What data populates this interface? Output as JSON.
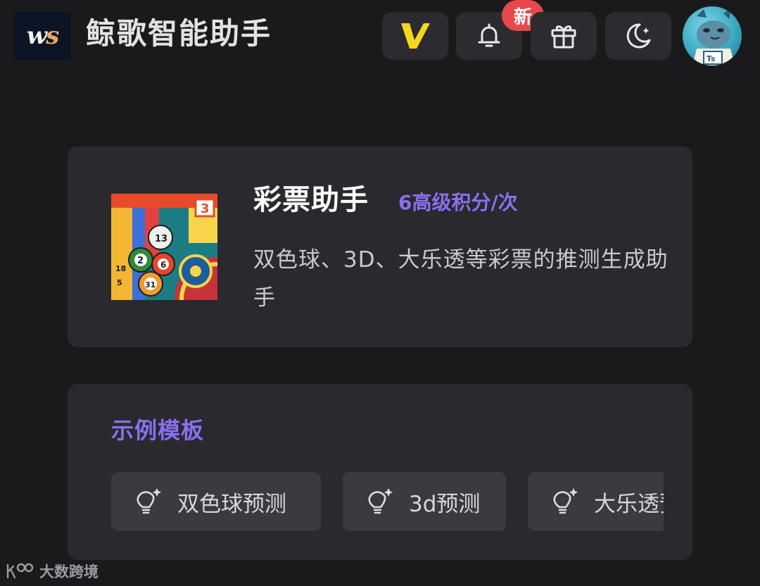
{
  "header": {
    "logo_text_w": "w",
    "logo_text_s": "s",
    "title": "鲸歌智能助手",
    "new_badge": "新",
    "vip_icon": "vip-v-icon",
    "bell_icon": "bell-icon",
    "gift_icon": "gift-icon",
    "theme_icon": "moon-icon",
    "avatar_icon": "user-avatar"
  },
  "tool": {
    "name": "彩票助手",
    "cost": "6高级积分/次",
    "description": "双色球、3D、大乐透等彩票的推测生成助手",
    "thumbnail_icon": "lottery-balls-image"
  },
  "examples": {
    "title": "示例模板",
    "chips": [
      {
        "label": "双色球预测",
        "icon": "lightbulb-sparkle-icon"
      },
      {
        "label": "3d预测",
        "icon": "lightbulb-sparkle-icon"
      },
      {
        "label": "大乐透预测",
        "icon": "lightbulb-sparkle-icon"
      }
    ]
  },
  "watermark": {
    "text": "大数跨境"
  },
  "colors": {
    "background": "#1a1a1c",
    "card": "#29292e",
    "accent_purple": "#8b6ff0",
    "badge_red": "#e5484d",
    "vip_yellow": "#f2d81c"
  }
}
